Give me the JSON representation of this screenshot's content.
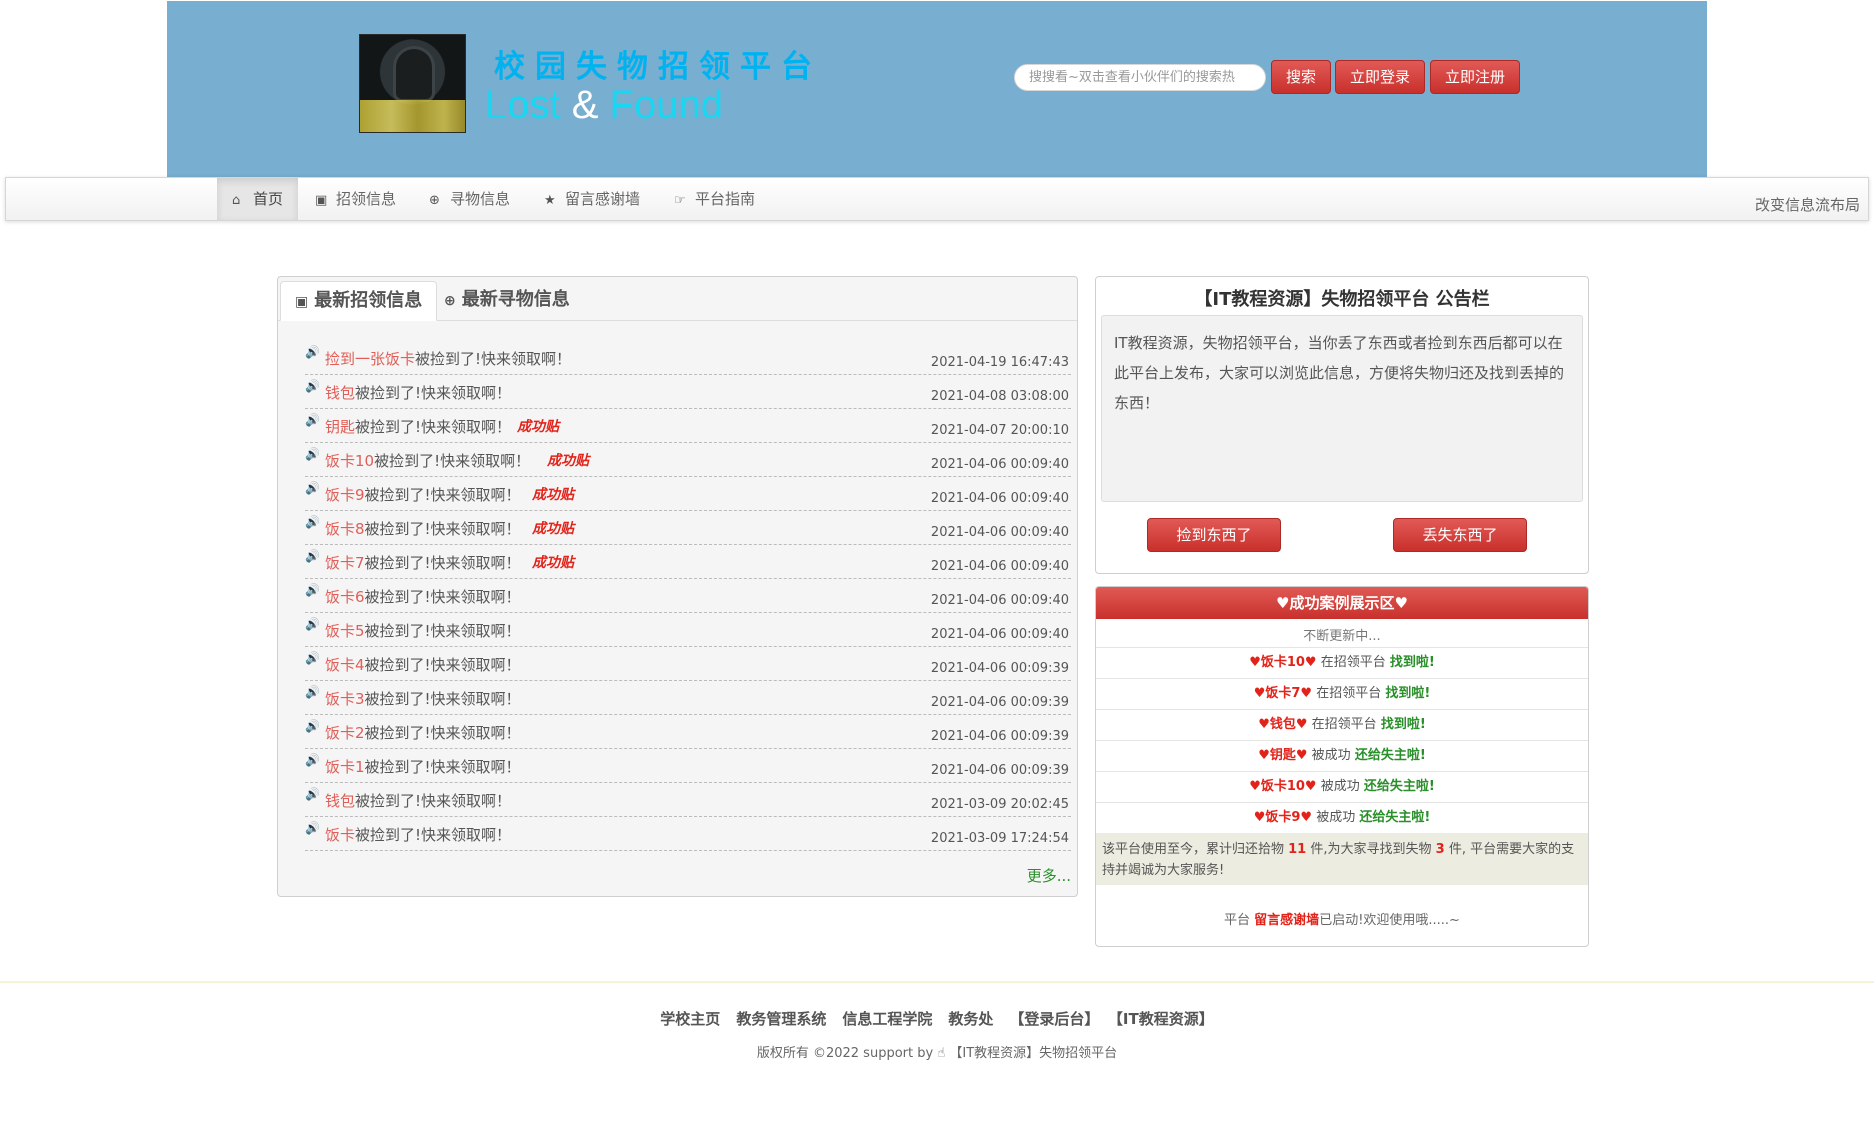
{
  "header": {
    "brand_cn": "校园失物招领平台",
    "brand_en_1": "Lost",
    "brand_en_amp": "&",
    "brand_en_2": "Found",
    "search_placeholder": "搜搜看~双击查看小伙伴们的搜索热",
    "search_button": "搜索",
    "login_button": "立即登录",
    "register_button": "立即注册"
  },
  "nav": {
    "items": [
      {
        "label": "首页",
        "icon": "home-icon"
      },
      {
        "label": "招领信息",
        "icon": "picture-icon"
      },
      {
        "label": "寻物信息",
        "icon": "zoom-icon"
      },
      {
        "label": "留言感谢墙",
        "icon": "star-icon"
      },
      {
        "label": "平台指南",
        "icon": "hand-right-icon"
      }
    ],
    "layout_link": "改变信息流布局"
  },
  "left": {
    "tab_found": "最新招领信息",
    "tab_lost": "最新寻物信息",
    "success_tag": "成功贴",
    "more": "更多...",
    "items": [
      {
        "name": "捡到一张饭卡",
        "text": "被捡到了!快来领取啊！",
        "date": "2021-04-19 16:47:43",
        "success": ""
      },
      {
        "name": "钱包",
        "text": "被捡到了!快来领取啊！",
        "date": "2021-04-08 03:08:00",
        "success": ""
      },
      {
        "name": "钥匙",
        "text": "被捡到了!快来领取啊！",
        "date": "2021-04-07 20:00:10",
        "success": "成功贴"
      },
      {
        "name": "饭卡10",
        "text": "被捡到了!快来领取啊！",
        "date": "2021-04-06 00:09:40",
        "success": "成功贴"
      },
      {
        "name": "饭卡9",
        "text": "被捡到了!快来领取啊！",
        "date": "2021-04-06 00:09:40",
        "success": "成功贴"
      },
      {
        "name": "饭卡8",
        "text": "被捡到了!快来领取啊！",
        "date": "2021-04-06 00:09:40",
        "success": "成功贴"
      },
      {
        "name": "饭卡7",
        "text": "被捡到了!快来领取啊！",
        "date": "2021-04-06 00:09:40",
        "success": "成功贴"
      },
      {
        "name": "饭卡6",
        "text": "被捡到了!快来领取啊！",
        "date": "2021-04-06 00:09:40",
        "success": ""
      },
      {
        "name": "饭卡5",
        "text": "被捡到了!快来领取啊！",
        "date": "2021-04-06 00:09:40",
        "success": ""
      },
      {
        "name": "饭卡4",
        "text": "被捡到了!快来领取啊！",
        "date": "2021-04-06 00:09:39",
        "success": ""
      },
      {
        "name": "饭卡3",
        "text": "被捡到了!快来领取啊！",
        "date": "2021-04-06 00:09:39",
        "success": ""
      },
      {
        "name": "饭卡2",
        "text": "被捡到了!快来领取啊！",
        "date": "2021-04-06 00:09:39",
        "success": ""
      },
      {
        "name": "饭卡1",
        "text": "被捡到了!快来领取啊！",
        "date": "2021-04-06 00:09:39",
        "success": ""
      },
      {
        "name": "钱包",
        "text": "被捡到了!快来领取啊！",
        "date": "2021-03-09 20:02:45",
        "success": ""
      },
      {
        "name": "饭卡",
        "text": "被捡到了!快来领取啊！",
        "date": "2021-03-09 17:24:54",
        "success": ""
      }
    ]
  },
  "notice": {
    "title": "【IT教程资源】失物招领平台 公告栏",
    "body": "IT教程资源，失物招领平台，当你丢了东西或者捡到东西后都可以在此平台上发布，大家可以浏览此信息，方便将失物归还及找到丢掉的东西！",
    "found_button": "捡到东西了",
    "lost_button": "丢失东西了"
  },
  "success": {
    "title": "♥成功案例展示区♥",
    "updating": "不断更新中...",
    "cases": [
      {
        "name": "♥饭卡10♥",
        "mid": " 在招领平台 ",
        "act": "找到啦!"
      },
      {
        "name": "♥饭卡7♥",
        "mid": " 在招领平台 ",
        "act": "找到啦!"
      },
      {
        "name": "♥钱包♥",
        "mid": " 在招领平台 ",
        "act": "找到啦!"
      },
      {
        "name": "♥钥匙♥",
        "mid": " 被成功 ",
        "act": "还给失主啦!"
      },
      {
        "name": "♥饭卡10♥",
        "mid": " 被成功 ",
        "act": "还给失主啦!"
      },
      {
        "name": "♥饭卡9♥",
        "mid": " 被成功 ",
        "act": "还给失主啦!"
      }
    ],
    "stats_1": "该平台使用至今，累计归还拾物 ",
    "stats_num_1": "11",
    "stats_2": " 件,为大家寻找到失物 ",
    "stats_num_2": "3",
    "stats_3": " 件, 平台需要大家的支持并竭诚为大家服务!",
    "thanks_1": "平台 ",
    "thanks_hl": "留言感谢墙",
    "thanks_2": "已启动!欢迎使用哦.....~"
  },
  "footer": {
    "links": [
      "学校主页",
      "教务管理系统",
      "信息工程学院",
      "教务处",
      "【登录后台】",
      "【IT教程资源】"
    ],
    "copyright_1": "版权所有 ©2022 support by ",
    "copyright_2": " 【IT教程资源】失物招领平台"
  }
}
